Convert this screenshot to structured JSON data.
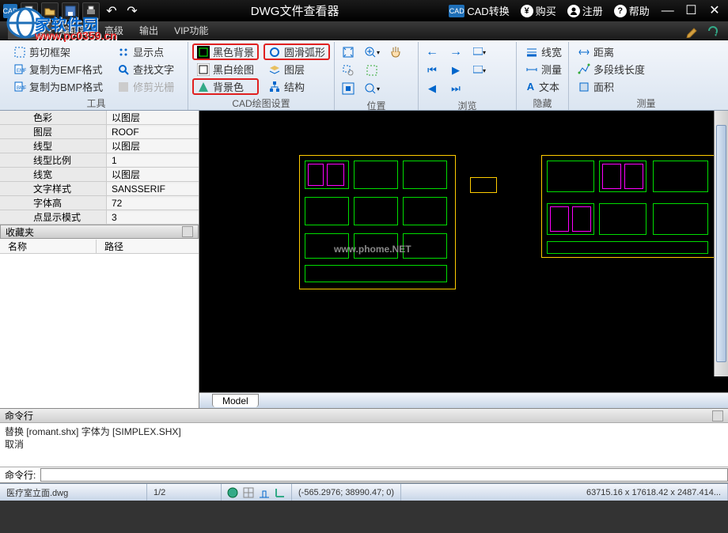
{
  "title": "DWG文件查看器",
  "qat": {
    "cad": "CAD"
  },
  "top_links": {
    "cad_convert": "CAD转换",
    "buy": "购买",
    "register": "注册",
    "help": "帮助"
  },
  "watermark": {
    "text": "家软件园",
    "url": "www.pc0359.cn"
  },
  "menu": {
    "items": [
      "查看器",
      "编辑器",
      "高级",
      "输出",
      "VIP功能"
    ],
    "active_index": 0
  },
  "ribbon": {
    "panel_tools": {
      "items": [
        "剪切框架",
        "显示点",
        "复制为EMF格式",
        "查找文字",
        "复制为BMP格式",
        "修剪光栅"
      ],
      "caption": "工具"
    },
    "panel_settings": {
      "col1": [
        "黑色背景",
        "黑白绘图",
        "背景色"
      ],
      "col2": [
        "圆滑弧形",
        "图层",
        "结构"
      ],
      "caption": "CAD绘图设置",
      "highlight_index": 2
    },
    "panel_position": {
      "caption": "位置"
    },
    "panel_browse": {
      "caption": "浏览"
    },
    "panel_view": {
      "items": [
        "线宽",
        "测量",
        "文本",
        "隐藏"
      ]
    },
    "panel_measure": {
      "items": [
        "距离",
        "多段线长度",
        "面积"
      ],
      "caption": "测量"
    }
  },
  "properties": [
    {
      "k": "色彩",
      "v": "以图层"
    },
    {
      "k": "图层",
      "v": "ROOF"
    },
    {
      "k": "线型",
      "v": "以图层"
    },
    {
      "k": "线型比例",
      "v": "1"
    },
    {
      "k": "线宽",
      "v": "以图层"
    },
    {
      "k": "文字样式",
      "v": "SANSSERIF"
    },
    {
      "k": "字体高",
      "v": "72"
    },
    {
      "k": "点显示模式",
      "v": "3"
    }
  ],
  "favorites": {
    "title": "收藏夹",
    "col_name": "名称",
    "col_path": "路径"
  },
  "canvas": {
    "watermark": "www.phome.NET"
  },
  "model_tab": "Model",
  "command": {
    "title": "命令行",
    "log1": "替换 [romant.shx] 字体为 [SIMPLEX.SHX]",
    "log2": "取消",
    "prompt": "命令行:"
  },
  "status": {
    "filename": "医疗室立面.dwg",
    "page": "1/2",
    "coords": "(-565.2976; 38990.47; 0)",
    "extents": "63715.16 x 17618.42 x 2487.414..."
  }
}
